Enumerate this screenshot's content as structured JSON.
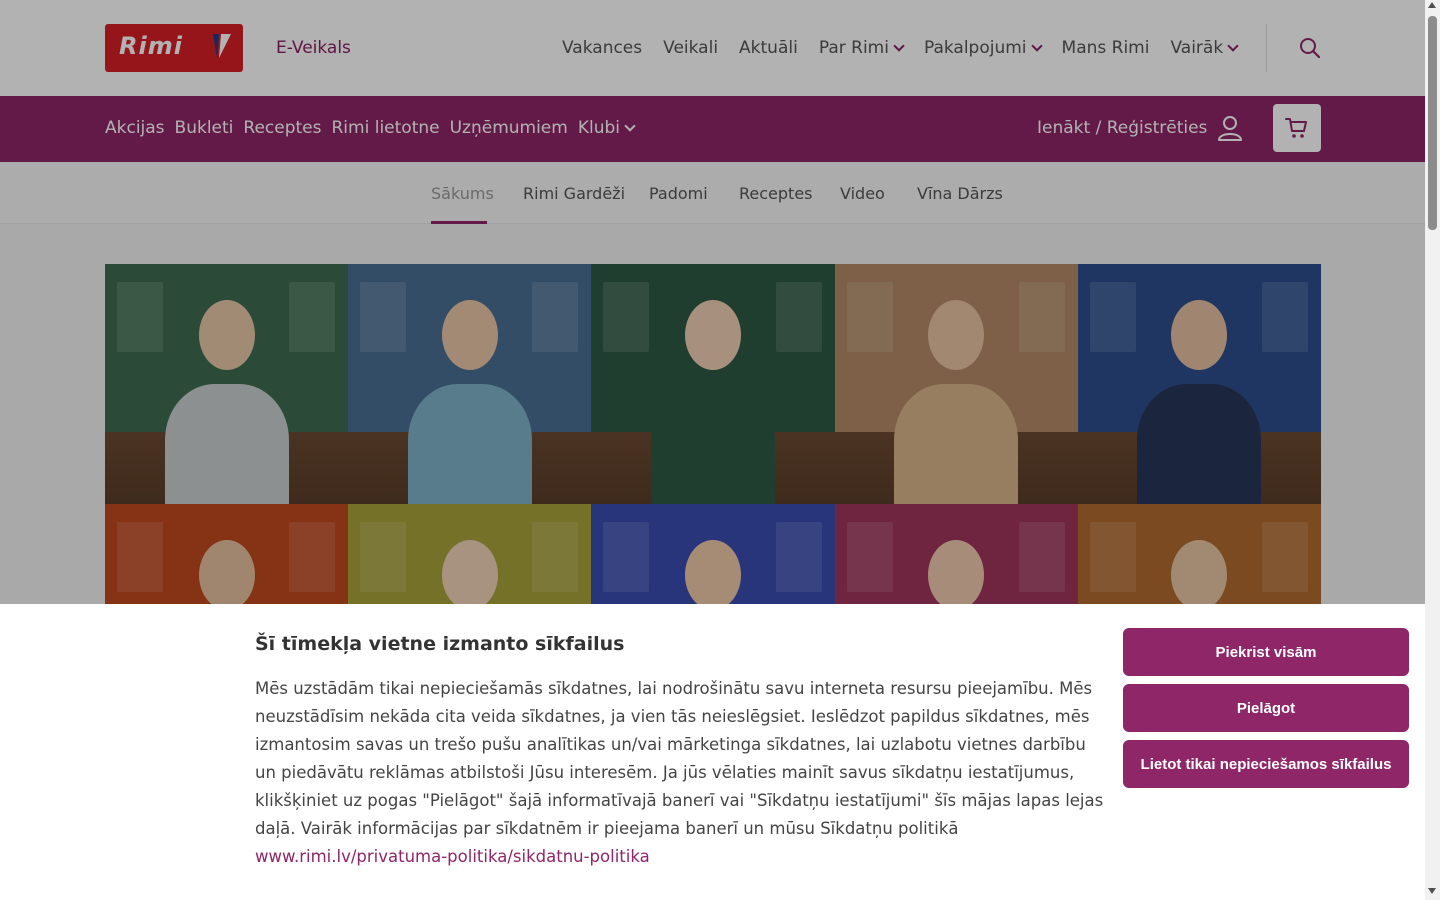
{
  "brand": {
    "logo_text": "Rimi",
    "eveikals": "E-Veikals"
  },
  "top_nav": {
    "items": [
      {
        "label": "Vakances",
        "dropdown": false
      },
      {
        "label": "Veikali",
        "dropdown": false
      },
      {
        "label": "Aktuāli",
        "dropdown": false
      },
      {
        "label": "Par Rimi",
        "dropdown": true
      },
      {
        "label": "Pakalpojumi",
        "dropdown": true
      },
      {
        "label": "Mans Rimi",
        "dropdown": false
      },
      {
        "label": "Vairāk",
        "dropdown": true
      }
    ]
  },
  "purple_nav": {
    "items": [
      {
        "label": "Akcijas"
      },
      {
        "label": "Bukleti"
      },
      {
        "label": "Receptes"
      },
      {
        "label": "Rimi lietotne"
      },
      {
        "label": "Uzņēmumiem"
      },
      {
        "label": "Klubi"
      }
    ],
    "login_label": "Ienākt / Reģistrēties"
  },
  "sub_nav": {
    "tabs": [
      {
        "label": "Sākums",
        "active": true
      },
      {
        "label": "Rimi Gardēži",
        "active": false
      },
      {
        "label": "Padomi",
        "active": false
      },
      {
        "label": "Receptes",
        "active": false
      },
      {
        "label": "Video",
        "active": false
      },
      {
        "label": "Vīna Dārzs",
        "active": false
      }
    ]
  },
  "cookie": {
    "title": "Šī tīmekļa vietne izmanto sīkfailus",
    "text": "Mēs uzstādām tikai nepieciešamās sīkdatnes, lai nodrošinātu savu interneta resursu pieejamību. Mēs neuzstādīsim nekāda cita veida sīkdatnes, ja vien tās neieslēgsiet. Ieslēdzot papildus sīkdatnes, mēs izmantosim savas un trešo pušu analītikas un/vai mārketinga sīkdatnes, lai uzlabotu vietnes darbību un piedāvātu reklāmas atbilstoši Jūsu interesēm. Ja jūs vēlaties mainīt savus sīkdatņu iestatījumus, klikšķiniet uz pogas \"Pielāgot\" šajā informatīvajā banerī vai \"Sīkdatņu iestatījumi\" šīs mājas lapas lejas daļā. Vairāk informācijas par sīkdatnēm ir pieejama banerī un mūsu Sīkdatņu politikā ",
    "link": "www.rimi.lv/privatuma-politika/sikdatnu-politika",
    "btn_accept": "Piekrist visām",
    "btn_customize": "Pielāgot",
    "btn_necessary": "Lietot tikai nepieciešamos sīkfailus"
  },
  "colors": {
    "brand_purple": "#8f2668",
    "logo_red": "#d61f26"
  },
  "icons": {
    "search": "search-icon",
    "user": "user-icon",
    "cart": "cart-icon",
    "chevron": "chevron-down-icon"
  }
}
